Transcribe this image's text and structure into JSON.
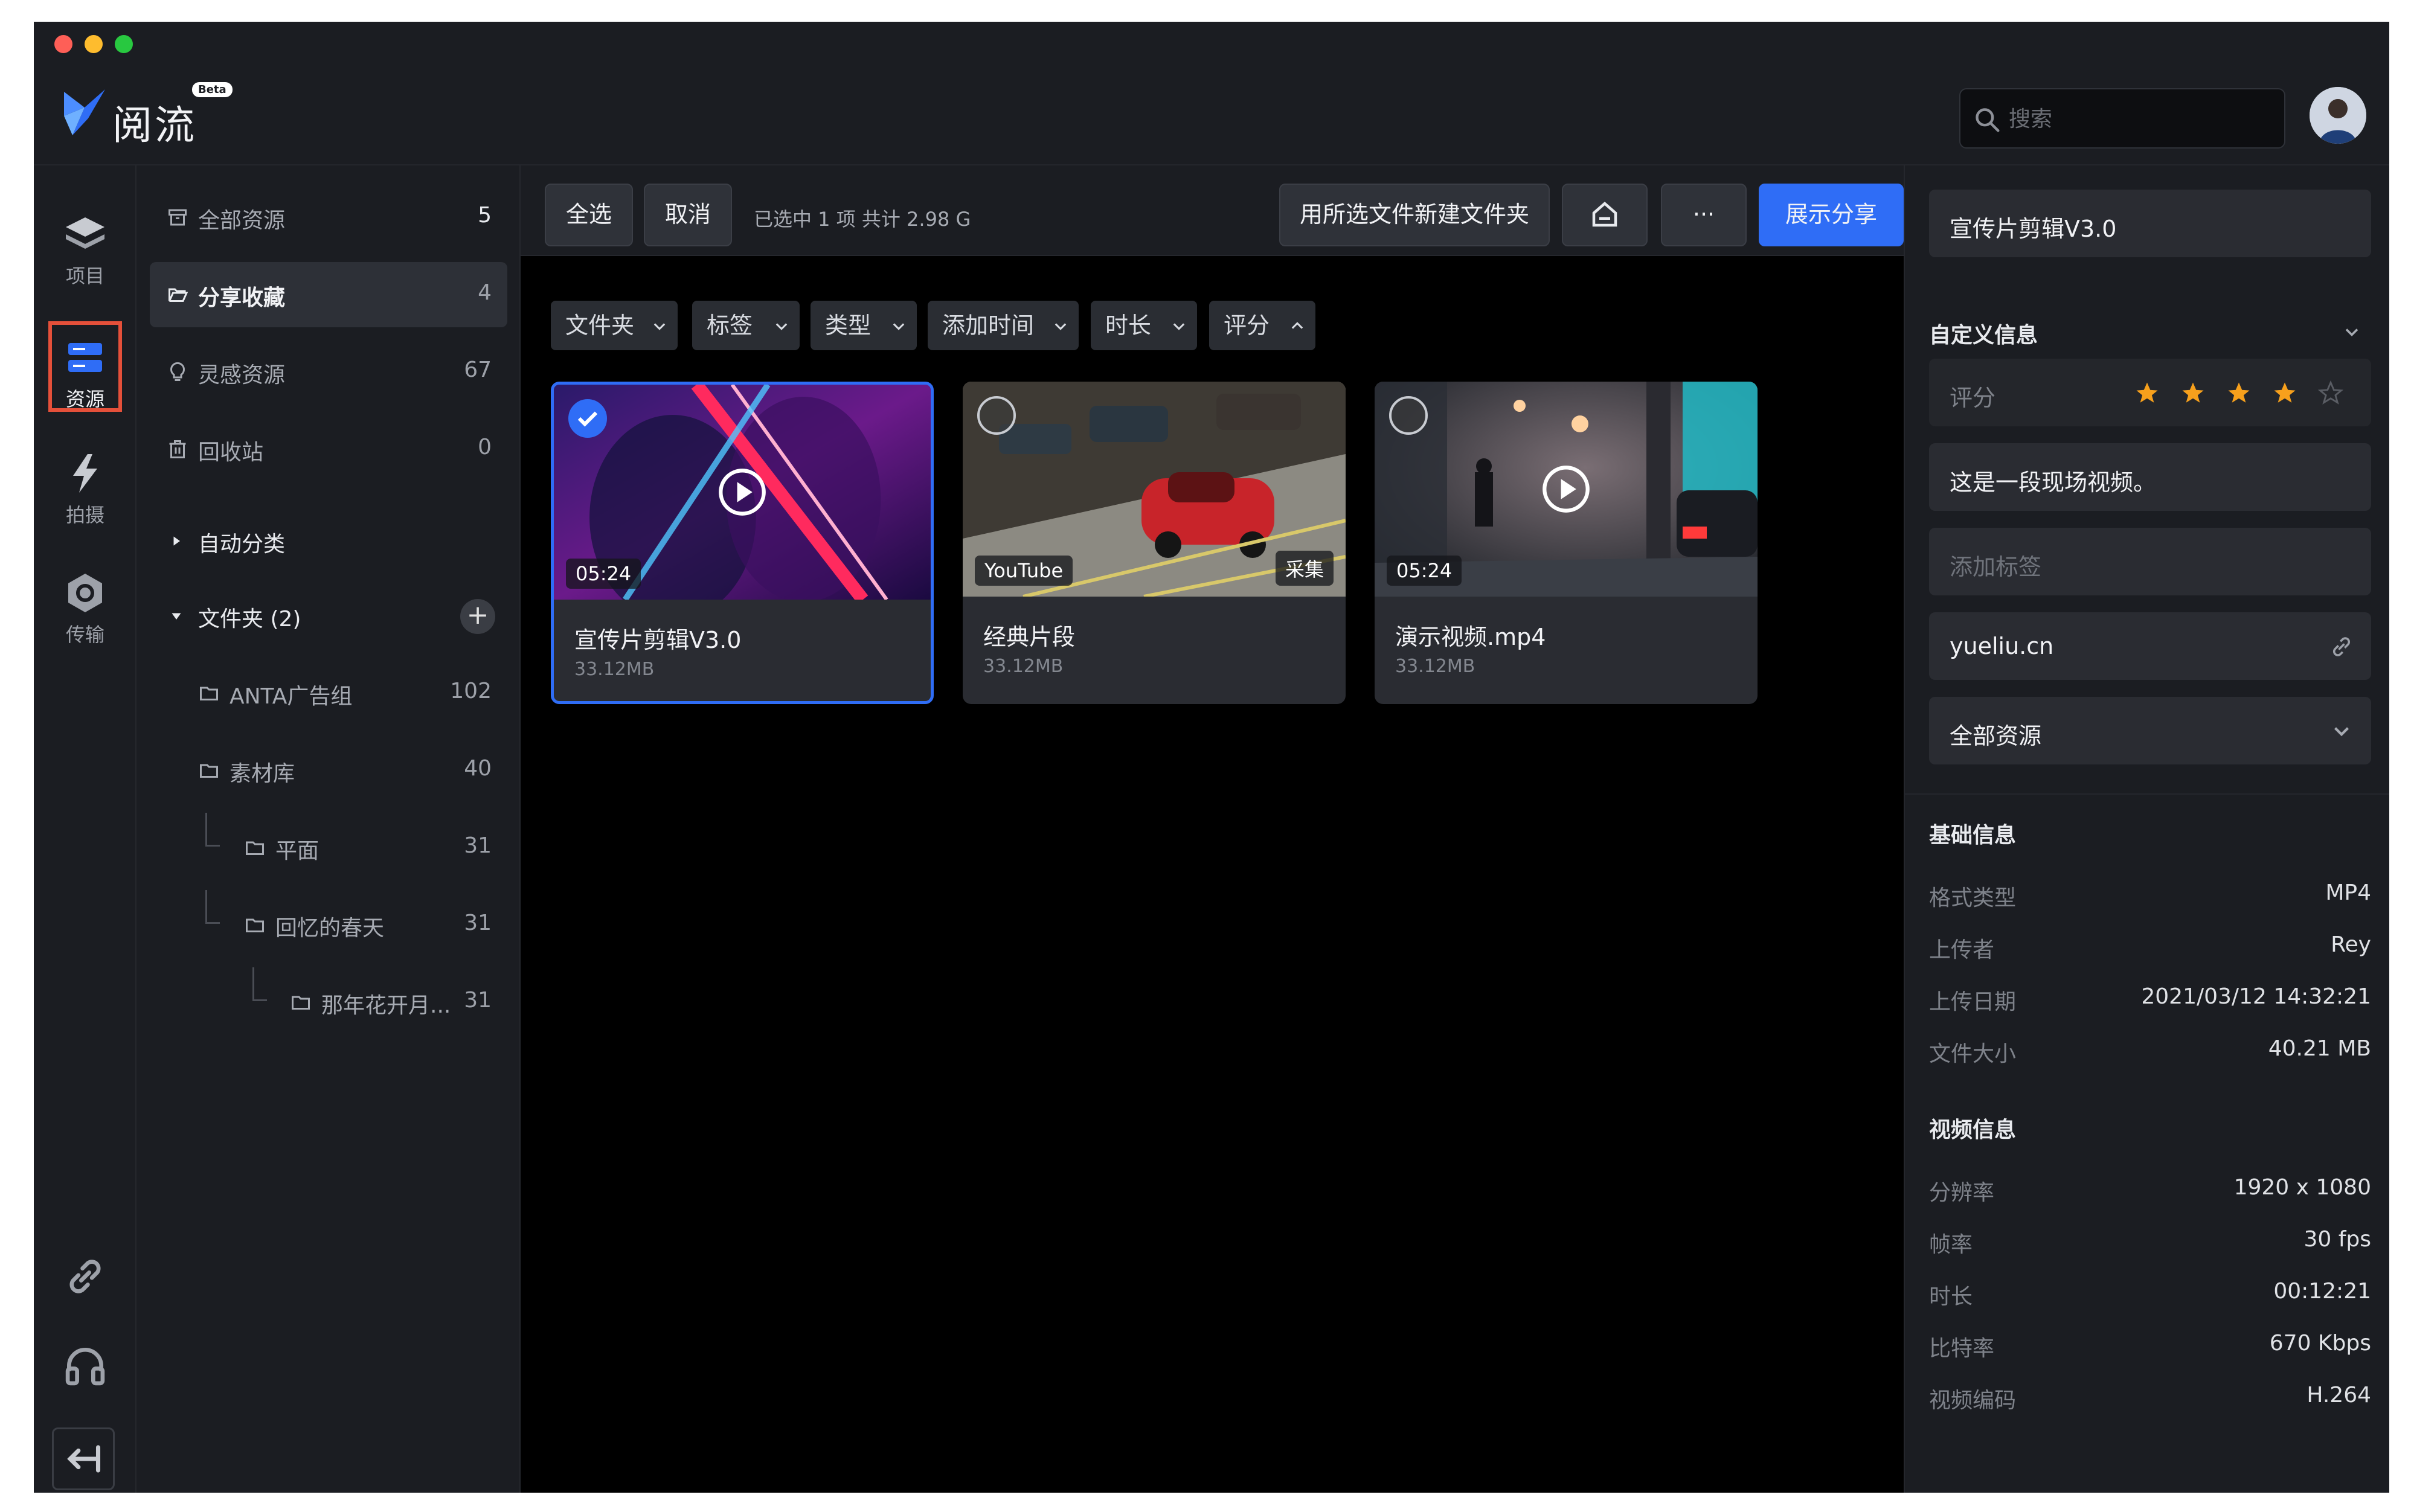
{
  "app": {
    "name": "阅流",
    "beta_label": "Beta",
    "search_placeholder": "搜索"
  },
  "rail": {
    "items": [
      {
        "label": "项目",
        "icon": "layers-icon"
      },
      {
        "label": "资源",
        "icon": "resources-icon"
      },
      {
        "label": "拍摄",
        "icon": "lightning-icon"
      },
      {
        "label": "传输",
        "icon": "transfer-icon"
      }
    ],
    "bottom_icons": [
      "link-icon",
      "headset-icon",
      "collapse-left-icon"
    ]
  },
  "nav": {
    "items": [
      {
        "label": "全部资源",
        "count": "5"
      },
      {
        "label": "分享收藏",
        "count": "4"
      },
      {
        "label": "灵感资源",
        "count": "67"
      },
      {
        "label": "回收站",
        "count": "0"
      }
    ],
    "auto_classify": "自动分类",
    "folders_header": "文件夹 (2)",
    "folders": [
      {
        "label": "ANTA广告组",
        "count": "102"
      },
      {
        "label": "素材库",
        "count": "40"
      },
      {
        "label": "平面",
        "count": "31"
      },
      {
        "label": "回忆的春天",
        "count": "31"
      },
      {
        "label": "那年花开月...",
        "count": "31"
      }
    ]
  },
  "toolbar": {
    "select_all": "全选",
    "cancel": "取消",
    "status": "已选中 1 项   共计 2.98 G",
    "new_folder": "用所选文件新建文件夹",
    "more": "···",
    "share": "展示分享"
  },
  "filters": [
    "文件夹",
    "标签",
    "类型",
    "添加时间",
    "时长",
    "评分"
  ],
  "cards": [
    {
      "title": "宣传片剪辑V3.0",
      "size": "33.12MB",
      "duration": "05:24",
      "selected": true
    },
    {
      "title": "经典片段",
      "size": "33.12MB",
      "source": "YouTube",
      "tag": "采集",
      "selected": false
    },
    {
      "title": "演示视频.mp4",
      "size": "33.12MB",
      "duration": "05:24",
      "selected": false
    }
  ],
  "panel": {
    "name": "宣传片剪辑V3.0",
    "custom_info_title": "自定义信息",
    "rating_label": "评分",
    "rating": 4,
    "rating_max": 5,
    "description": "这是一段现场视频。",
    "tag_placeholder": "添加标签",
    "link": "yueliu.cn",
    "location": "全部资源",
    "basic_title": "基础信息",
    "basic": [
      {
        "k": "格式类型",
        "v": "MP4"
      },
      {
        "k": "上传者",
        "v": "Rey"
      },
      {
        "k": "上传日期",
        "v": "2021/03/12 14:32:21"
      },
      {
        "k": "文件大小",
        "v": "40.21 MB"
      }
    ],
    "video_title": "视频信息",
    "video": [
      {
        "k": "分辨率",
        "v": "1920 x 1080"
      },
      {
        "k": "帧率",
        "v": "30 fps"
      },
      {
        "k": "时长",
        "v": "00:12:21"
      },
      {
        "k": "比特率",
        "v": "670 Kbps"
      },
      {
        "k": "视频编码",
        "v": "H.264"
      }
    ]
  },
  "colors": {
    "accent": "#2f6df6",
    "star": "#f7a01c",
    "highlight_border": "#e5503a"
  }
}
